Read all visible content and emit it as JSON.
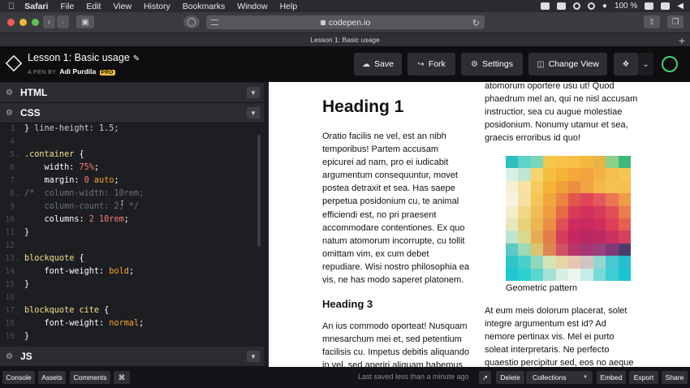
{
  "macos": {
    "menu": [
      "Safari",
      "File",
      "Edit",
      "View",
      "History",
      "Bookmarks",
      "Window",
      "Help"
    ],
    "battery": "100 %"
  },
  "browser": {
    "url": "codepen.io",
    "tab_title": "Lesson 1: Basic usage"
  },
  "pen": {
    "title": "Lesson 1: Basic usage",
    "by_label": "A PEN BY",
    "author": "Adi Purdila",
    "badge": "PRO"
  },
  "actions": {
    "save": "Save",
    "fork": "Fork",
    "settings": "Settings",
    "change_view": "Change View"
  },
  "panels": {
    "html": "HTML",
    "css": "CSS",
    "js": "JS"
  },
  "css_code": [
    {
      "n": "3",
      "text": "}"
    },
    {
      "n": "4",
      "text": ""
    },
    {
      "n": "5",
      "text": ".container {"
    },
    {
      "n": "6",
      "text": "    width: 75%;"
    },
    {
      "n": "7",
      "text": "    margin: 0 auto;"
    },
    {
      "n": "8",
      "text": "/*  column-width: 10rem;"
    },
    {
      "n": "9",
      "text": "    column-count: 2; */"
    },
    {
      "n": "10",
      "text": "    columns: 2 10rem;"
    },
    {
      "n": "11",
      "text": "}"
    },
    {
      "n": "12",
      "text": ""
    },
    {
      "n": "13",
      "text": "blockquote {"
    },
    {
      "n": "14",
      "text": "    font-weight: bold;"
    },
    {
      "n": "15",
      "text": "}"
    },
    {
      "n": "16",
      "text": ""
    },
    {
      "n": "17",
      "text": "blockquote cite {"
    },
    {
      "n": "18",
      "text": "    font-weight: normal;"
    },
    {
      "n": "19",
      "text": "}"
    }
  ],
  "css_partial_top": "  line-height: 1.5;",
  "preview": {
    "heading1": "Heading 1",
    "para1": "Oratio facilis ne vel, est an nibh temporibus! Partem accusam epicurei ad nam, pro ei iudicabit argumentum consequuntur, movet postea detraxit et sea. Has saepe perpetua posidonium cu, te animal efficiendi est, no pri praesent accommodare contentiones. Ex quo natum atomorum incorrupte, cu tollit omittam vim, ex cum debet repudiare. Wisi nostro philosophia ea vis, ne has modo saperet platonem.",
    "heading3": "Heading 3",
    "para2": "An ius commodo oporteat! Nusquam mnesarchum mei et, sed petentium facilisis cu. Impetus debitis aliquando in vel, sed aperiri aliquam habemus ne. No justo perpetua quo, elit",
    "col2_para1": "atomorum oportere usu ut! Quod phaedrum mel an, qui ne nisl accusam instructior, sea cu augue molestiae posidonium. Nonumy utamur et sea, graecis erroribus id quo!",
    "caption": "Geometric pattern",
    "col2_para2": "At eum meis dolorum placerat, solet integre argumentum est id? Ad nemore pertinax vis. Mel ei purto soleat interpretaris. Ne perfecto quaestio percipitur sed, eos no aeque sensibus"
  },
  "footer": {
    "console": "Console",
    "assets": "Assets",
    "comments": "Comments",
    "shortcuts": "⌘",
    "saved": "Last saved less than a minute ago",
    "delete": "Delete",
    "collections": "Collections",
    "embed": "Embed",
    "export": "Export",
    "share": "Share"
  },
  "colors": {
    "codepen_green": "#47cf73",
    "pro_badge": "#f3c33b",
    "selector": "#f6e08f",
    "value": "#fda331",
    "number": "#ff7a7a"
  },
  "pattern_colors": [
    "#2fbfbf",
    "#5fd3c9",
    "#7ad7bd",
    "#f2c84b",
    "#f6c24a",
    "#f7bf45",
    "#f6b73e",
    "#e8b345",
    "#8dcf8a",
    "#3eb97a",
    "#d9efe6",
    "#bfe6d2",
    "#f6d36e",
    "#f5c040",
    "#f6b237",
    "#f4a83a",
    "#f1a43d",
    "#f3b243",
    "#f5be4d",
    "#f6c653",
    "#f6efd7",
    "#f6e3a4",
    "#f4cb5c",
    "#f4b43a",
    "#f19f3a",
    "#ec8f40",
    "#f2a444",
    "#f5b94c",
    "#f5c152",
    "#f4c04e",
    "#f7f2e0",
    "#f4e1a2",
    "#f2c554",
    "#f0a63a",
    "#ea8440",
    "#e2574c",
    "#e2455a",
    "#e3595b",
    "#ea7751",
    "#f09b46",
    "#f5eccc",
    "#f2d688",
    "#efbd55",
    "#ed9f40",
    "#e66b45",
    "#d93a58",
    "#d2315d",
    "#d73a5b",
    "#e34f58",
    "#ec7b4d",
    "#e6e6c0",
    "#e7d27a",
    "#eab552",
    "#e98f44",
    "#df4f54",
    "#cc2b5f",
    "#c8295f",
    "#cf2d5d",
    "#dd3f58",
    "#e65f52",
    "#bfe3d0",
    "#d7d98f",
    "#e6ac54",
    "#e37d49",
    "#d63d5a",
    "#c42761",
    "#b92a63",
    "#bd2a62",
    "#cb3061",
    "#d6405c",
    "#5cc9c4",
    "#9fd7b7",
    "#d9c56f",
    "#dd8753",
    "#d14f61",
    "#b8356b",
    "#a53773",
    "#9d3f7d",
    "#7f3a78",
    "#4d3b6e",
    "#2ec6c9",
    "#49cfc7",
    "#8fd8bd",
    "#d5e3b5",
    "#e4d4a6",
    "#e6c8b0",
    "#d4c3c4",
    "#94d5cf",
    "#47c8cf",
    "#27bfd0",
    "#1fc7cf",
    "#2dd0d0",
    "#5bd6cf",
    "#a4e2d6",
    "#d8efe4",
    "#eef6ef",
    "#c6ece6",
    "#75dbd3",
    "#3bcfd2",
    "#1bc4d2"
  ]
}
